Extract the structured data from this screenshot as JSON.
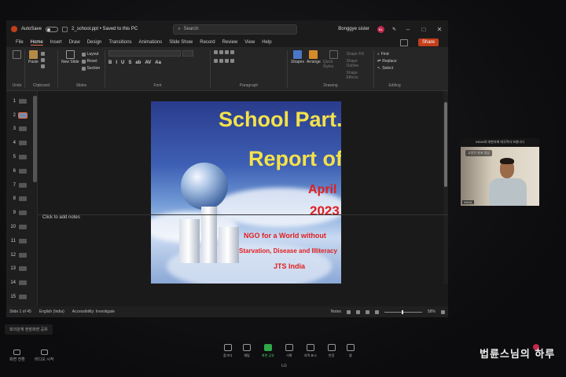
{
  "window": {
    "autosave_label": "AutoSave",
    "autosave_state": "Off",
    "file_name": "2_school.ppt • Saved to this PC",
    "search_placeholder": "Search",
    "user_name": "Bonggye sister",
    "user_initials": "BL",
    "minimize": "–",
    "maximize": "□",
    "close": "✕"
  },
  "tabs": [
    "File",
    "Home",
    "Insert",
    "Draw",
    "Design",
    "Transitions",
    "Animations",
    "Slide Show",
    "Record",
    "Review",
    "View",
    "Help"
  ],
  "active_tab": "Home",
  "share_label": "Share",
  "ribbon": {
    "undo_label": "Undo",
    "clipboard_label": "Clipboard",
    "paste_label": "Paste",
    "new_slide_label": "New Slide",
    "layout_label": "Layout",
    "reset_label": "Reset",
    "section_label": "Section",
    "slides_label": "Slides",
    "font_label": "Font",
    "paragraph_label": "Paragraph",
    "shapes_label": "Shapes",
    "arrange_label": "Arrange",
    "quick_styles_label": "Quick Styles",
    "shape_fill_label": "Shape Fill",
    "shape_outline_label": "Shape Outline",
    "shape_effects_label": "Shape Effects",
    "drawing_label": "Drawing",
    "find_label": "Find",
    "replace_label": "Replace",
    "select_label": "Select",
    "editing_label": "Editing",
    "format_buttons": [
      "B",
      "I",
      "U",
      "S",
      "ab",
      "AV",
      "Aa"
    ]
  },
  "thumbnails": [
    "1",
    "2",
    "3",
    "4",
    "5",
    "6",
    "7",
    "8",
    "9",
    "10",
    "11",
    "12",
    "13",
    "14",
    "15"
  ],
  "active_slide": "2",
  "slide": {
    "title_line1": "School Part.",
    "title_line2": "Report of",
    "month": "April",
    "year": "2023",
    "tagline1": "NGO for a World without",
    "tagline2": "Starvation, Disease and Illiteracy",
    "org": "JTS India"
  },
  "notes_placeholder": "Click to add notes",
  "status": {
    "slide_of": "Slide 1 of 45",
    "language": "English (India)",
    "accessibility": "Accessibility: Investigate",
    "notes_label": "Notes",
    "zoom": "58%"
  },
  "video": {
    "caption": "INDIA의 대한지회 대국학사 보살나다",
    "participant": "INDIA",
    "pill": "고정된 발표 영상"
  },
  "conference": {
    "notice": "회의관계 현장화면 공유",
    "left_controls": [
      "화면 전환",
      "비디오 시작"
    ],
    "tools": [
      "참가자",
      "채팅",
      "화면 공유",
      "기록",
      "자막 표시",
      "반응",
      "앱"
    ],
    "tv_brand": "LG"
  },
  "watermark": "법륜스님의 하루"
}
